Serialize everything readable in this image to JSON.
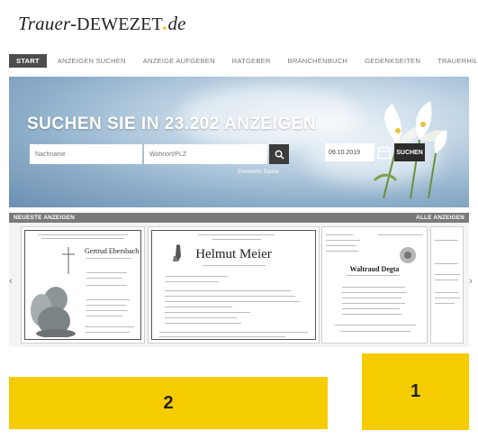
{
  "logo": {
    "part1": "Trauer-",
    "part2": "DEWEZET",
    "dot": ".",
    "part3": "de"
  },
  "nav": {
    "items": [
      "START",
      "ANZEIGEN SUCHEN",
      "ANZEIGE AUFGEBEN",
      "RATGEBER",
      "BRANCHENBUCH",
      "GEDENKSEITEN",
      "TRAUERHILFE"
    ]
  },
  "hero": {
    "title": "SUCHEN SIE IN 23.202 ANZEIGEN",
    "name_placeholder": "Nachname",
    "place_placeholder": "Wohnort/PLZ",
    "extended_link": "Erweiterte Suche",
    "date_value": "09.10.2019",
    "search_button": "SUCHEN"
  },
  "section": {
    "title": "NEUESTE ANZEIGEN",
    "all_link": "ALLE ANZEIGEN"
  },
  "cards": [
    {
      "name": "Gertrud Ebersbach"
    },
    {
      "name": "Helmut Meier"
    },
    {
      "name": "Waltraud Degta"
    }
  ],
  "arrows": {
    "prev": "‹",
    "next": "›"
  },
  "markers": {
    "left": "2",
    "right": "1"
  },
  "colors": {
    "accent": "#f5cc00",
    "nav_active": "#4d4d4d",
    "section_bar": "#7a7a7a",
    "button": "#2d2d2d"
  }
}
